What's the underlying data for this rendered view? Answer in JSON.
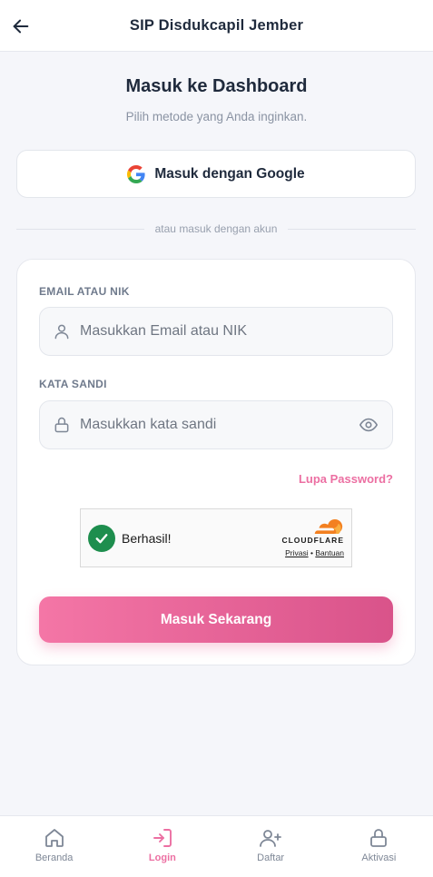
{
  "header": {
    "title": "SIP Disdukcapil Jember",
    "back_icon": "arrow-left-icon"
  },
  "page": {
    "heading": "Masuk ke Dashboard",
    "subheading": "Pilih metode yang Anda inginkan."
  },
  "google": {
    "label": "Masuk dengan Google",
    "icon": "google-icon"
  },
  "divider": {
    "text": "atau masuk dengan akun"
  },
  "form": {
    "email_label": "EMAIL ATAU NIK",
    "email_placeholder": "Masukkan Email atau NIK",
    "email_value": "",
    "password_label": "KATA SANDI",
    "password_placeholder": "Masukkan kata sandi",
    "password_value": "",
    "forgot_label": "Lupa Password?",
    "submit_label": "Masuk Sekarang"
  },
  "captcha": {
    "status": "Berhasil!",
    "brand": "CLOUDFLARE",
    "privacy_link": "Privasi",
    "separator": "•",
    "help_link": "Bantuan"
  },
  "bottom_nav": {
    "items": [
      {
        "label": "Beranda",
        "icon": "home-icon",
        "active": false
      },
      {
        "label": "Login",
        "icon": "login-icon",
        "active": true
      },
      {
        "label": "Daftar",
        "icon": "user-plus-icon",
        "active": false
      },
      {
        "label": "Aktivasi",
        "icon": "lock-icon",
        "active": false
      }
    ]
  },
  "colors": {
    "accent": "#ec6fa2",
    "accent_dark": "#d9538a",
    "text": "#1f2a3c",
    "muted": "#8a93a3",
    "background": "#f5f6fa",
    "success": "#1e8e4e",
    "cloudflare_orange": "#f38020"
  }
}
